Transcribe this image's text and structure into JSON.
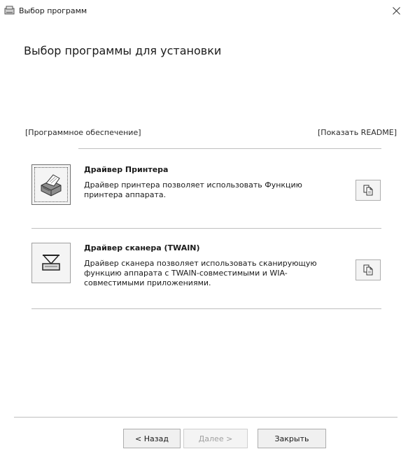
{
  "window": {
    "title": "Выбор программ",
    "icon": "installer-app-icon",
    "close_icon": "close-icon"
  },
  "page": {
    "title": "Выбор программы для установки"
  },
  "list_header": {
    "left": "[Программное обеспечение]",
    "right": "[Показать README]"
  },
  "programs": [
    {
      "name": "Драйвер Принтера",
      "description": "Драйвер принтера позволяет использовать Функцию принтера аппарата.",
      "icon": "printer-icon",
      "readme_icon": "document-icon"
    },
    {
      "name": "Драйвер сканера (TWAIN)",
      "description": "Драйвер сканера позволяет использовать сканирующую функцию аппарата с TWAIN-совместимыми и WIA-совместимыми приложениями.",
      "icon": "scanner-icon",
      "readme_icon": "document-icon"
    }
  ],
  "buttons": {
    "back": "< Назад",
    "next": "Далее >",
    "close": "Закрыть"
  }
}
